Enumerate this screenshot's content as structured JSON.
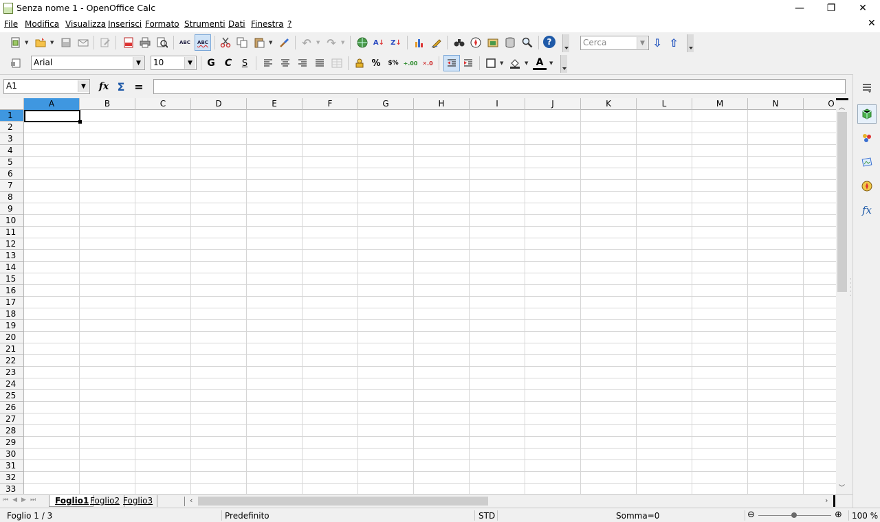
{
  "window": {
    "title": "Senza nome 1 - OpenOffice Calc",
    "minimize": "—",
    "maximize": "❐",
    "close": "✕",
    "doc_close": "✕"
  },
  "menu": {
    "items": [
      "File",
      "Modifica",
      "Visualizza",
      "Inserisci",
      "Formato",
      "Strumenti",
      "Dati",
      "Finestra",
      "?"
    ]
  },
  "toolbar": {
    "search_placeholder": "Cerca",
    "help_label": "?",
    "spell_label": "ABC",
    "autospell_label": "ABC"
  },
  "format_toolbar": {
    "font_name": "Arial",
    "font_size": "10",
    "bold": "G",
    "italic": "C",
    "underline": "S",
    "percent": "%",
    "currency": "$%"
  },
  "formula_bar": {
    "name_box": "A1",
    "function_wizard": "fx",
    "sum": "Σ",
    "equals": "=",
    "content": ""
  },
  "sheet": {
    "columns": [
      "A",
      "B",
      "C",
      "D",
      "E",
      "F",
      "G",
      "H",
      "I",
      "J",
      "K",
      "L",
      "M",
      "N",
      "O"
    ],
    "rows": [
      "1",
      "2",
      "3",
      "4",
      "5",
      "6",
      "7",
      "8",
      "9",
      "10",
      "11",
      "12",
      "13",
      "14",
      "15",
      "16",
      "17",
      "18",
      "19",
      "20",
      "21",
      "22",
      "23",
      "24",
      "25",
      "26",
      "27",
      "28",
      "29",
      "30",
      "31",
      "32",
      "33"
    ],
    "selected_cell": "A1"
  },
  "tabs": [
    "Foglio1",
    "Foglio2",
    "Foglio3"
  ],
  "active_tab": "Foglio1",
  "status": {
    "sheet": "Foglio 1 / 3",
    "style": "Predefinito",
    "mode": "STD",
    "sum": "Somma=0",
    "zoom": "100 %",
    "zoom_minus": "⊖",
    "zoom_plus": "⊕"
  },
  "colors": {
    "selection_header": "#3f97e0",
    "grid_line": "#d6d6d6",
    "accent": "#3a6fd0"
  }
}
